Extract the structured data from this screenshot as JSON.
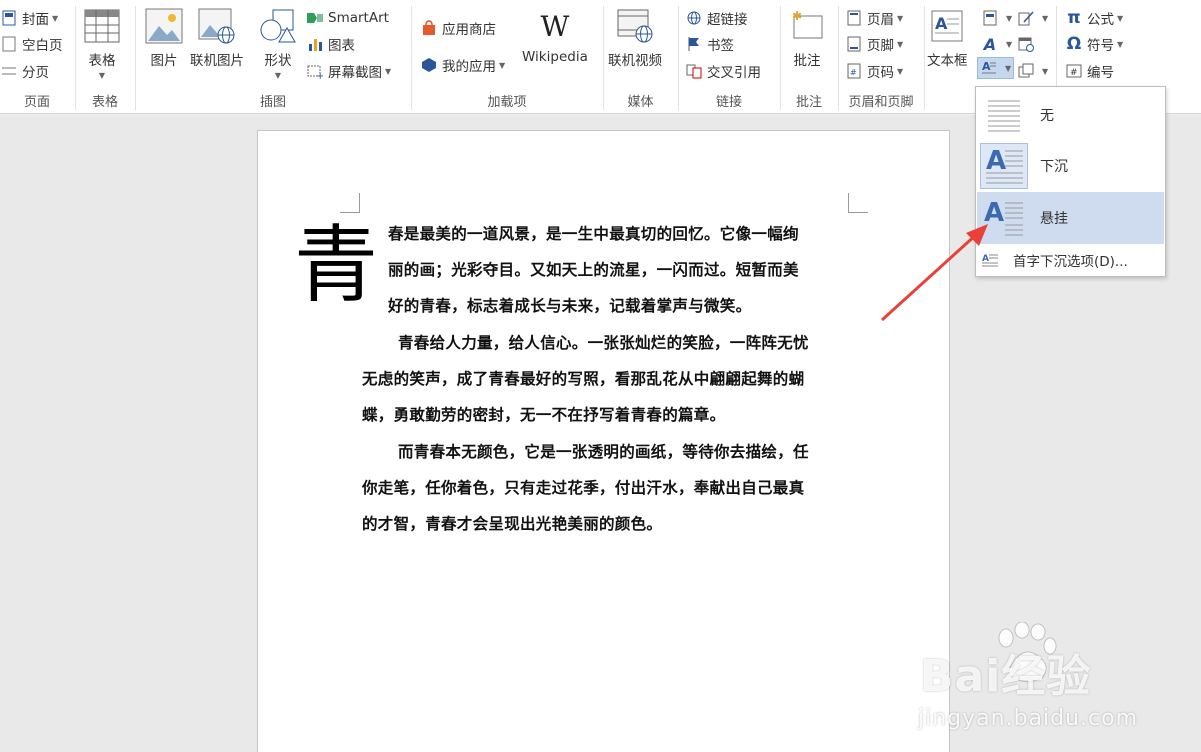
{
  "ribbon": {
    "groups": {
      "pages": {
        "label": "页面",
        "cover": "封面",
        "blank": "空白页",
        "break": "分页"
      },
      "tables": {
        "label": "表格",
        "table": "表格"
      },
      "illustrations": {
        "label": "插图",
        "picture": "图片",
        "online_picture": "联机图片",
        "shapes": "形状",
        "smartart": "SmartArt",
        "chart": "图表",
        "screenshot": "屏幕截图"
      },
      "addins": {
        "label": "加载项",
        "store": "应用商店",
        "my_apps": "我的应用",
        "wikipedia": "Wikipedia"
      },
      "media": {
        "label": "媒体",
        "online_video": "联机视频"
      },
      "links": {
        "label": "链接",
        "hyperlink": "超链接",
        "bookmark": "书签",
        "cross_reference": "交叉引用"
      },
      "comments": {
        "label": "批注",
        "comment": "批注"
      },
      "header_footer": {
        "label": "页眉和页脚",
        "header": "页眉",
        "footer": "页脚",
        "page_number": "页码"
      },
      "text": {
        "textbox": "文本框"
      },
      "symbols": {
        "equation": "公式",
        "symbol": "符号",
        "number": "编号"
      }
    }
  },
  "document": {
    "drop_cap": "青",
    "lines": [
      "春是最美的一道风景，是一生中最真切的回忆。它像一幅绚",
      "丽的画；光彩夺目。又如天上的流星，一闪而过。短暂而美",
      "好的青春，标志着成长与未来，记载着掌声与微笑。",
      "青春给人力量，给人信心。一张张灿烂的笑脸，一阵阵无忧",
      "无虑的笑声，成了青春最好的写照，看那乱花从中翩翩起舞的蝴",
      "蝶，勇敢勤劳的密封，无一不在抒写着青春的篇章。",
      "而青春本无颜色，它是一张透明的画纸，等待你去描绘，任",
      "你走笔，任你着色，只有走过花季，付出汗水，奉献出自己最真",
      "的才智，青春才会呈现出光艳美丽的颜色。"
    ]
  },
  "dropcap_menu": {
    "none": "无",
    "dropped": "下沉",
    "in_margin": "悬挂",
    "options": "首字下沉选项(D)..."
  },
  "watermark": {
    "brand": "Bai经验",
    "url": "jingyan.baidu.com"
  },
  "colors": {
    "accent": "#2b579a",
    "hover": "#cfdcf0",
    "arrow": "#e8413a"
  }
}
